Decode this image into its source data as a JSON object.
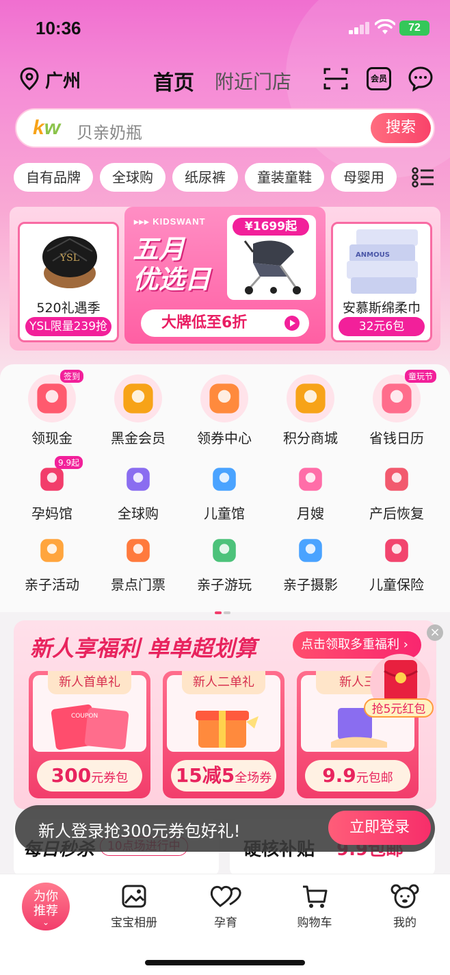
{
  "status": {
    "time": "10:36",
    "battery": "72"
  },
  "header": {
    "location": "广州",
    "tab_home": "首页",
    "tab_nearby": "附近门店",
    "member_icon_text": "会员"
  },
  "search": {
    "brand": [
      "k",
      "w"
    ],
    "placeholder": "贝亲奶瓶",
    "button": "搜索"
  },
  "quick_categories": [
    "自有品牌",
    "全球购",
    "纸尿裤",
    "童装童鞋",
    "母婴用"
  ],
  "banners": {
    "left": {
      "title": "520礼遇季",
      "tag": "YSL限量239抢"
    },
    "center": {
      "brand": "▸▸▸ KIDSWANT",
      "title_line1": "五月",
      "title_line2": "优选日",
      "price": "¥1699起",
      "cta": "大牌低至6折"
    },
    "right": {
      "title": "安慕斯绵柔巾",
      "tag": "32元6包",
      "product_text": "ANMOUS"
    }
  },
  "grid": [
    {
      "label": "领现金",
      "icon": "red-envelope-icon",
      "badge": "签到"
    },
    {
      "label": "黑金会员",
      "icon": "vip-crown-icon",
      "badge": ""
    },
    {
      "label": "领券中心",
      "icon": "coupon-ticket-icon",
      "badge": ""
    },
    {
      "label": "积分商城",
      "icon": "points-store-house-icon",
      "badge": ""
    },
    {
      "label": "省钱日历",
      "icon": "calendar-icon",
      "badge": "童玩节"
    },
    {
      "label": "孕妈馆",
      "icon": "pregnant-mom-icon",
      "badge": "9.9起"
    },
    {
      "label": "全球购",
      "icon": "global-plane-icon",
      "badge": ""
    },
    {
      "label": "儿童馆",
      "icon": "kids-hall-icon",
      "badge": ""
    },
    {
      "label": "月嫂",
      "icon": "nanny-icon",
      "badge": ""
    },
    {
      "label": "产后恢复",
      "icon": "postpartum-yoga-icon",
      "badge": ""
    },
    {
      "label": "亲子活动",
      "icon": "family-activity-icon",
      "badge": ""
    },
    {
      "label": "景点门票",
      "icon": "scenic-ticket-icon",
      "badge": ""
    },
    {
      "label": "亲子游玩",
      "icon": "family-play-icon",
      "badge": ""
    },
    {
      "label": "亲子摄影",
      "icon": "camera-icon",
      "badge": ""
    },
    {
      "label": "儿童保险",
      "icon": "insurance-icon",
      "badge": ""
    }
  ],
  "newuser": {
    "title": "新人享福利 单单超划算",
    "claim": "点击领取多重福利 ›",
    "gifts": [
      {
        "head": "新人首单礼",
        "big": "300",
        "small": "元券包",
        "art": "COUPON"
      },
      {
        "head": "新人二单礼",
        "big": "15减5",
        "small": "全场券",
        "art": ""
      },
      {
        "head": "新人三",
        "big": "9.9",
        "small": "元包邮",
        "art": ""
      }
    ],
    "redpack_label": "抢5元红包",
    "close": "×"
  },
  "sections": {
    "daily": "每日秒杀",
    "round": "10点场进行中",
    "hard": "硬核补贴",
    "nine": "9.9包邮"
  },
  "toast": {
    "text": "新人登录抢300元券包好礼!",
    "button": "立即登录"
  },
  "bottom_nav": {
    "recommend_line1": "为你",
    "recommend_line2": "推荐",
    "album": "宝宝相册",
    "pregnancy": "孕育",
    "cart": "购物车",
    "mine": "我的"
  },
  "colors": {
    "brand_pink": "#f2209a",
    "accent_red": "#e8245e"
  }
}
